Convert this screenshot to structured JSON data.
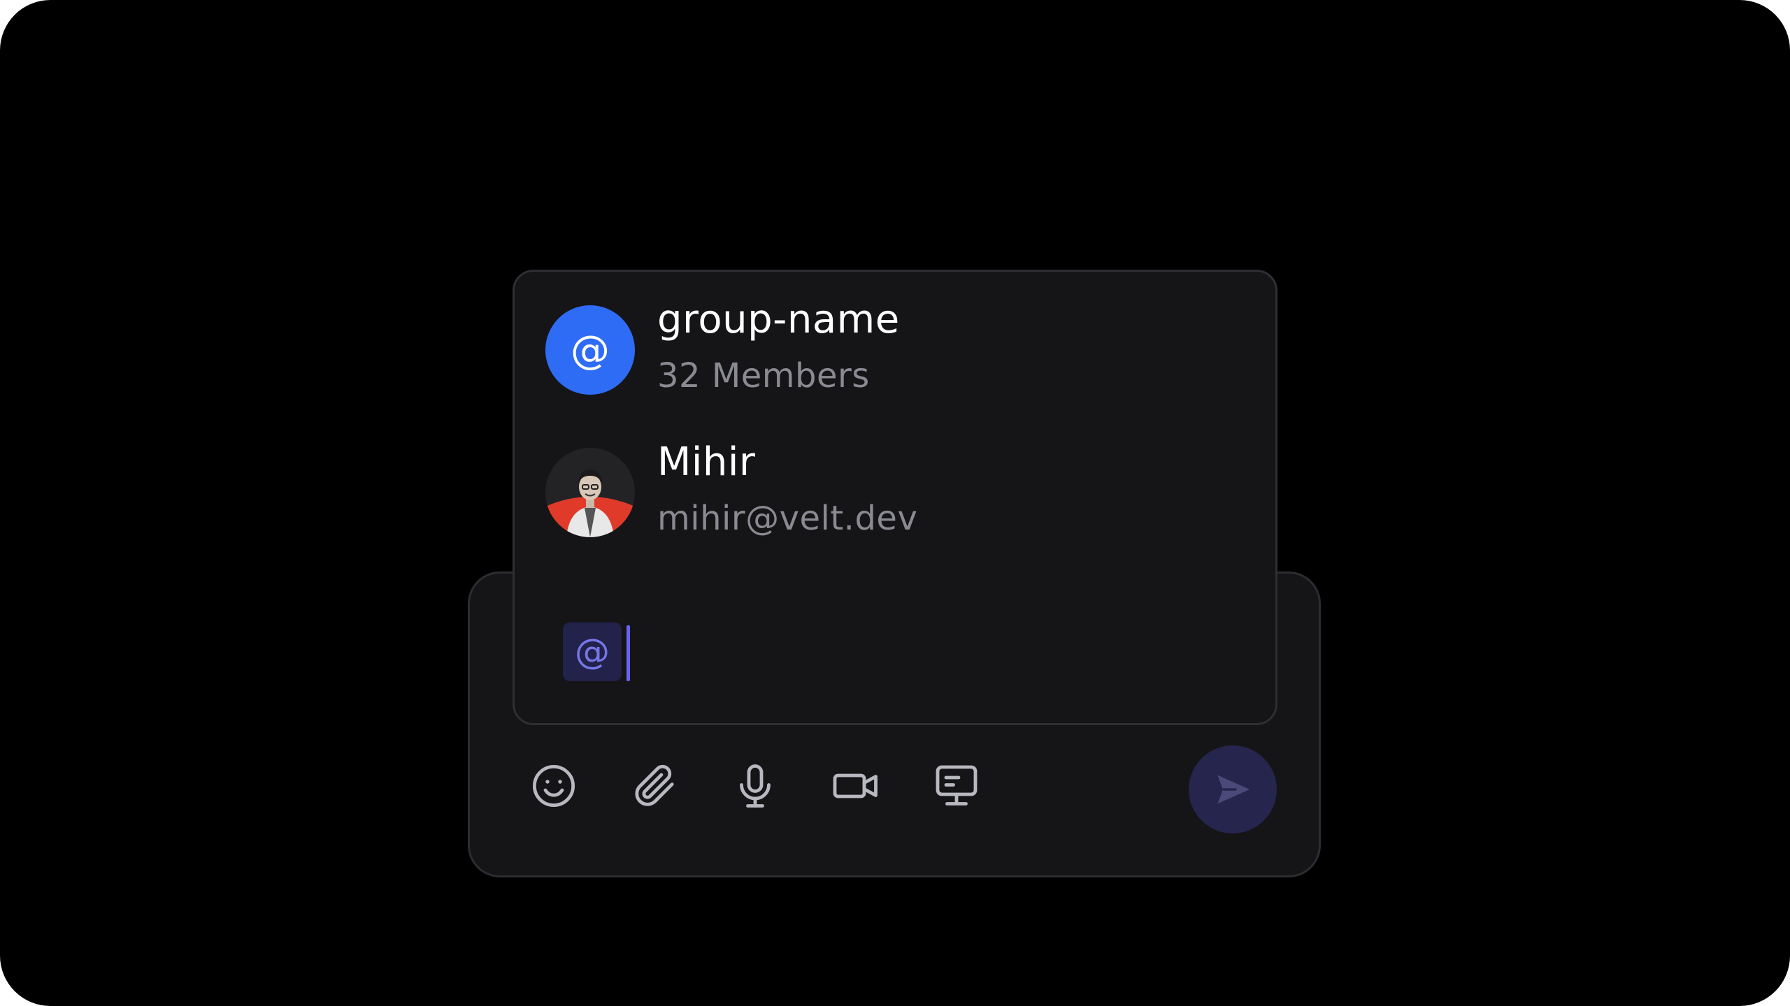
{
  "mention_list": {
    "items": [
      {
        "name": "group-name",
        "subtitle": "32 Members",
        "avatar_text": "@",
        "avatar_color": "#2f6cf6"
      },
      {
        "name": "Mihir",
        "subtitle": "mihir@velt.dev",
        "avatar_icon": "user-photo"
      }
    ]
  },
  "composer": {
    "mention_trigger": "@",
    "toolbar": {
      "icons": [
        "emoji-icon",
        "paperclip-icon",
        "microphone-icon",
        "video-camera-icon",
        "screen-share-icon"
      ]
    },
    "send_icon": "send-icon",
    "send_button_color": "#25254d"
  },
  "colors": {
    "background": "#000000",
    "card": "#151518",
    "accent": "#6a62f0",
    "icon": "#b8b8c0"
  }
}
